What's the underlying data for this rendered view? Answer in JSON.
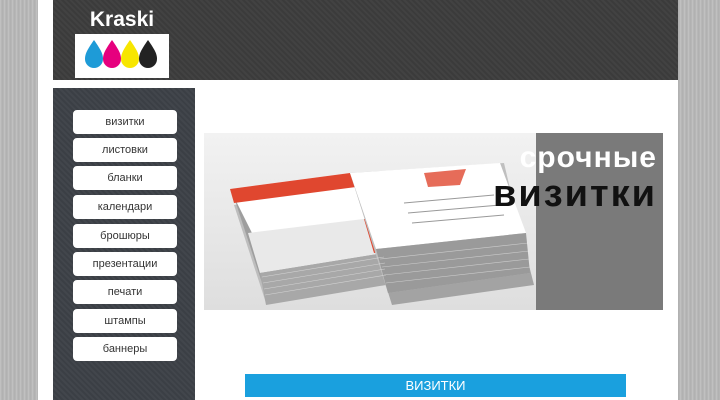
{
  "logo": {
    "text": "Kraski",
    "ink_colors": [
      "#1e9bd7",
      "#e6007e",
      "#f7e600",
      "#222222"
    ]
  },
  "sidebar": {
    "items": [
      {
        "label": "визитки"
      },
      {
        "label": "листовки"
      },
      {
        "label": "бланки"
      },
      {
        "label": "календари"
      },
      {
        "label": "брошюры"
      },
      {
        "label": "презентации"
      },
      {
        "label": "печати"
      },
      {
        "label": "штампы"
      },
      {
        "label": "баннеры"
      }
    ]
  },
  "banner": {
    "line1": "срочные",
    "line2": "визитки"
  },
  "section": {
    "title": "ВИЗИТКИ"
  },
  "colors": {
    "accent": "#1aa0de",
    "dark": "#3b3b3b"
  }
}
